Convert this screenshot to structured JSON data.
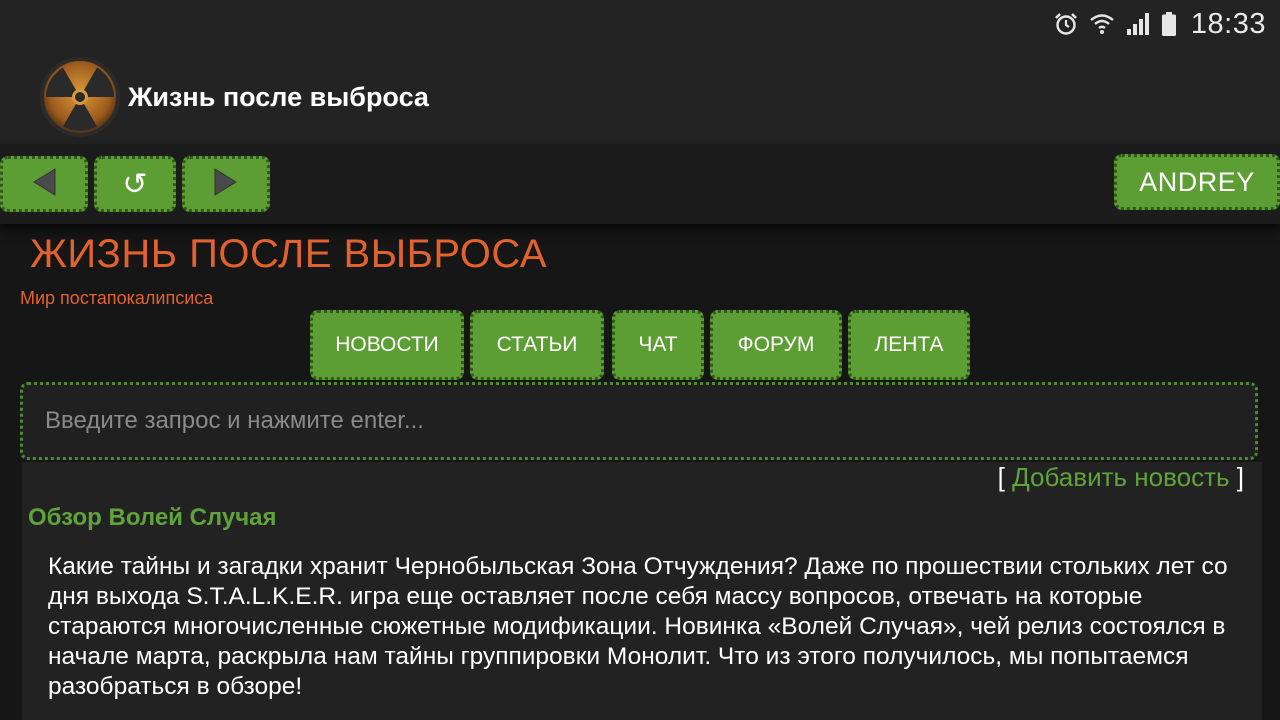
{
  "status_bar": {
    "time": "18:33",
    "icons": [
      "alarm-icon",
      "wifi-icon",
      "signal-icon",
      "battery-icon"
    ]
  },
  "app_bar": {
    "title": "Жизнь после выброса",
    "logo_icon": "radiation-icon"
  },
  "toolbar": {
    "back_icon": "triangle-left-icon",
    "reload_glyph": "↺",
    "forward_icon": "triangle-right-icon",
    "user_label": "ANDREY"
  },
  "site": {
    "title": "ЖИЗНЬ ПОСЛЕ ВЫБРОСА",
    "subtitle": "Мир постапокалипсиса"
  },
  "nav": [
    {
      "label": "НОВОСТИ"
    },
    {
      "label": "СТАТЬИ"
    },
    {
      "label": "ЧАТ"
    },
    {
      "label": "ФОРУМ"
    },
    {
      "label": "ЛЕНТА"
    }
  ],
  "search": {
    "placeholder": "Введите запрос и нажмите enter..."
  },
  "content": {
    "add_news_open": "[",
    "add_news_label": "Добавить новость",
    "add_news_close": "]",
    "article_title": "Обзор Волей Случая",
    "article_text": "Какие тайны и загадки хранит Чернобыльская Зона Отчуждения? Даже по прошествии стольких лет со дня выхода S.T.A.L.K.E.R. игра еще оставляет после себя массу вопросов, отвечать на которые стараются многочисленные сюжетные модификации. Новинка «Волей Случая», чей релиз состоялся в начале марта, раскрыла нам тайны группировки Монолит. Что из этого получилось, мы попытаемся разобраться в обзоре!"
  },
  "colors": {
    "accent_green": "#5d9e34",
    "link_green": "#5fa33a",
    "title_orange": "#e2622f",
    "background": "#161616"
  }
}
